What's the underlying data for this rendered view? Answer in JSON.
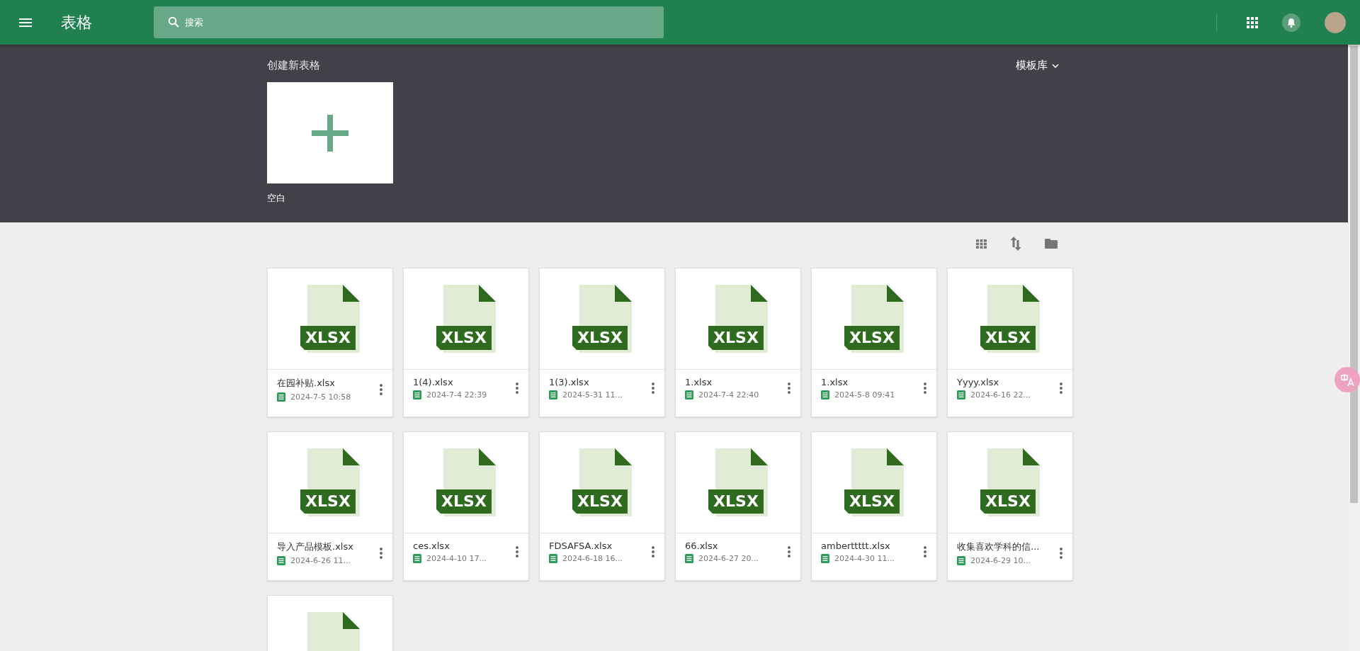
{
  "app_bar": {
    "title": "表格",
    "search": {
      "placeholder": "搜索"
    }
  },
  "create": {
    "heading": "创建新表格",
    "template_gallery": "模板库",
    "templates": [
      {
        "label": "空白"
      }
    ]
  },
  "files": [
    {
      "kind": "file",
      "badge": "XLSX",
      "name": "在园补贴.xlsx",
      "date": "2024-7-5 10:58"
    },
    {
      "kind": "file",
      "badge": "XLSX",
      "name": "1(4).xlsx",
      "date": "2024-7-4 22:39"
    },
    {
      "kind": "file",
      "badge": "XLSX",
      "name": "1(3).xlsx",
      "date": "2024-5-31 11..."
    },
    {
      "kind": "file",
      "badge": "XLSX",
      "name": "1.xlsx",
      "date": "2024-7-4 22:40"
    },
    {
      "kind": "file",
      "badge": "XLSX",
      "name": "1.xlsx",
      "date": "2024-5-8 09:41"
    },
    {
      "kind": "file",
      "badge": "XLSX",
      "name": "Yyyy.xlsx",
      "date": "2024-6-16 22..."
    },
    {
      "kind": "file",
      "badge": "XLSX",
      "name": "导入产品模板.xlsx",
      "date": "2024-6-26 11..."
    },
    {
      "kind": "file",
      "badge": "XLSX",
      "name": "ces.xlsx",
      "date": "2024-4-10 17..."
    },
    {
      "kind": "file",
      "badge": "XLSX",
      "name": "FDSAFSA.xlsx",
      "date": "2024-6-18 16..."
    },
    {
      "kind": "file",
      "badge": "XLSX",
      "name": "66.xlsx",
      "date": "2024-6-27 20..."
    },
    {
      "kind": "file",
      "badge": "XLSX",
      "name": "amberttttt.xlsx",
      "date": "2024-4-30 11..."
    },
    {
      "kind": "file",
      "badge": "XLSX",
      "name": "收集喜欢学科的信...",
      "date": "2024-6-29 10..."
    },
    {
      "kind": "cut-off"
    }
  ]
}
